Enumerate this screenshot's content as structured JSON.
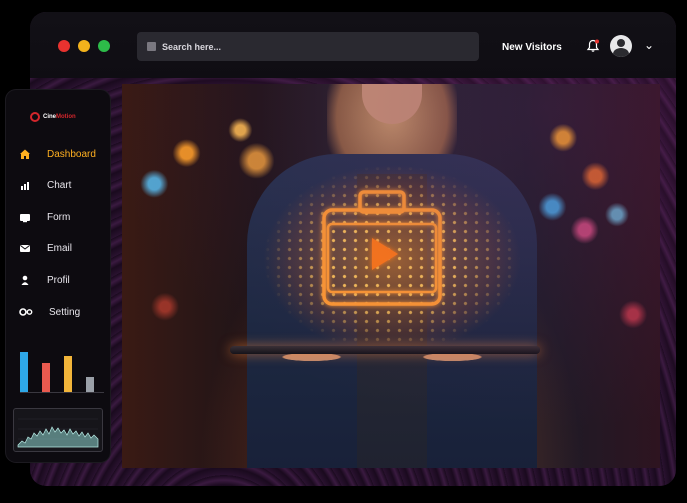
{
  "window": {
    "traffic_lights": [
      "#e8322f",
      "#f3b21c",
      "#2dbb49"
    ]
  },
  "header": {
    "search_placeholder": "Search here...",
    "visitors_label": "New Visitors",
    "notification_dot_color": "#e8322f"
  },
  "sidebar": {
    "logo_prefix": "Cine",
    "logo_suffix": "Motion",
    "items": [
      {
        "label": "Dashboard",
        "icon": "home-icon",
        "active": true
      },
      {
        "label": "Chart",
        "icon": "bar-chart-icon",
        "active": false
      },
      {
        "label": "Form",
        "icon": "form-icon",
        "active": false
      },
      {
        "label": "Email",
        "icon": "mail-icon",
        "active": false
      },
      {
        "label": "Profil",
        "icon": "user-icon",
        "active": false
      },
      {
        "label": "Setting",
        "icon": "gear-icon",
        "active": false
      }
    ],
    "accent_color": "#ffb020"
  },
  "chart_data": [
    {
      "type": "bar",
      "values": [
        42,
        30,
        38,
        16
      ],
      "colors": [
        "#2ea8e8",
        "#e95a4f",
        "#f2b53a",
        "#9aa0a8"
      ],
      "title": "",
      "xlabel": "",
      "ylabel": ""
    },
    {
      "type": "area",
      "title": "",
      "color": "#8fd6d0"
    }
  ],
  "hero": {
    "icon": "video-briefcase-icon",
    "accent_color": "#ff8a1e"
  }
}
